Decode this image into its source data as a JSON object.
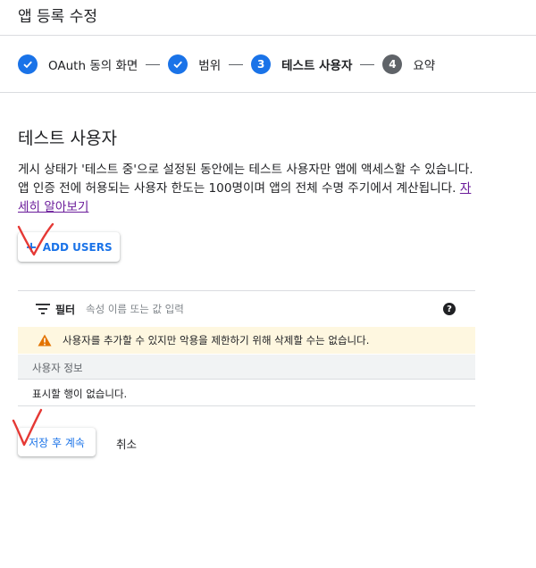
{
  "header": {
    "title": "앱 등록 수정"
  },
  "stepper": {
    "steps": [
      {
        "label": "OAuth 동의 화면",
        "state": "done"
      },
      {
        "label": "범위",
        "state": "done"
      },
      {
        "number": "3",
        "label": "테스트 사용자",
        "state": "active"
      },
      {
        "number": "4",
        "label": "요약",
        "state": "inactive"
      }
    ]
  },
  "section": {
    "title": "테스트 사용자",
    "description": "게시 상태가 '테스트 중'으로 설정된 동안에는 테스트 사용자만 앱에 액세스할 수 있습니다. 앱 인증 전에 허용되는 사용자 한도는 100명이며 앱의 전체 수명 주기에서 계산됩니다.",
    "learn_more": "자세히 알아보기"
  },
  "add_users_button": {
    "label": "ADD USERS",
    "icon": "plus-icon"
  },
  "filter": {
    "label": "필터",
    "placeholder": "속성 이름 또는 값 입력",
    "help_icon": "help-icon"
  },
  "warning": {
    "text": "사용자를 추가할 수 있지만 악용을 제한하기 위해 삭제할 수는 없습니다.",
    "icon": "warning-icon"
  },
  "table": {
    "columns": [
      "사용자 정보"
    ],
    "empty_message": "표시할 행이 없습니다."
  },
  "actions": {
    "save_label": "저장 후 계속",
    "cancel_label": "취소"
  },
  "colors": {
    "accent": "#1a73e8",
    "warning_bg": "#fef7e0",
    "warning_icon": "#e37400",
    "annotation": "#e53935",
    "link": "#6a1b9a"
  }
}
